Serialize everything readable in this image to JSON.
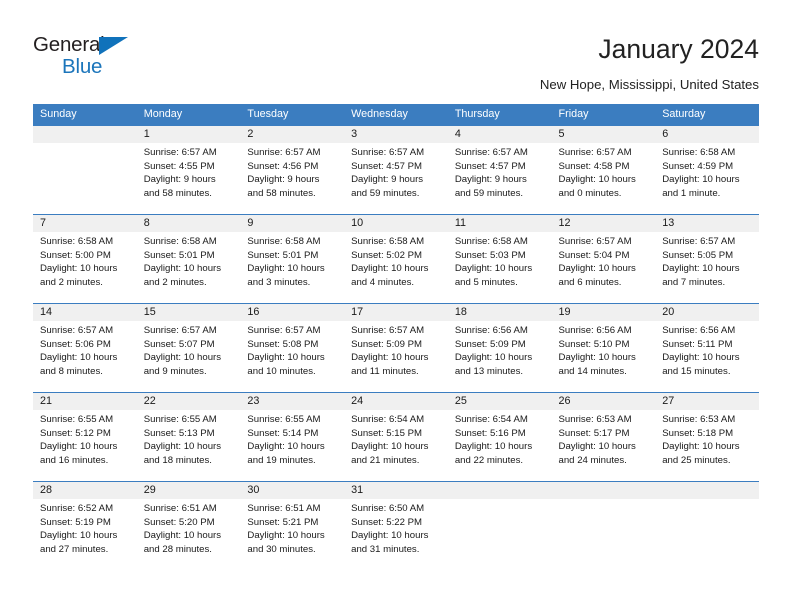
{
  "brand": {
    "name_top": "General",
    "name_bottom": "Blue",
    "triangle_icon": "brand-triangle-icon",
    "color_dark": "#231f20",
    "color_blue": "#1b75bb"
  },
  "header": {
    "title": "January 2024",
    "subtitle": "New Hope, Mississippi, United States"
  },
  "theme": {
    "header_bg": "#3b7dc0",
    "header_text": "#ffffff",
    "daynum_bg": "#f0f0f0",
    "rule_color": "#3b7dc0",
    "body_text": "#1a1a1a"
  },
  "calendar": {
    "weekday_headers": [
      "Sunday",
      "Monday",
      "Tuesday",
      "Wednesday",
      "Thursday",
      "Friday",
      "Saturday"
    ],
    "weeks": [
      [
        {
          "day": "",
          "sunrise": "",
          "sunset": "",
          "daylight_1": "",
          "daylight_2": ""
        },
        {
          "day": "1",
          "sunrise": "Sunrise: 6:57 AM",
          "sunset": "Sunset: 4:55 PM",
          "daylight_1": "Daylight: 9 hours",
          "daylight_2": "and 58 minutes."
        },
        {
          "day": "2",
          "sunrise": "Sunrise: 6:57 AM",
          "sunset": "Sunset: 4:56 PM",
          "daylight_1": "Daylight: 9 hours",
          "daylight_2": "and 58 minutes."
        },
        {
          "day": "3",
          "sunrise": "Sunrise: 6:57 AM",
          "sunset": "Sunset: 4:57 PM",
          "daylight_1": "Daylight: 9 hours",
          "daylight_2": "and 59 minutes."
        },
        {
          "day": "4",
          "sunrise": "Sunrise: 6:57 AM",
          "sunset": "Sunset: 4:57 PM",
          "daylight_1": "Daylight: 9 hours",
          "daylight_2": "and 59 minutes."
        },
        {
          "day": "5",
          "sunrise": "Sunrise: 6:57 AM",
          "sunset": "Sunset: 4:58 PM",
          "daylight_1": "Daylight: 10 hours",
          "daylight_2": "and 0 minutes."
        },
        {
          "day": "6",
          "sunrise": "Sunrise: 6:58 AM",
          "sunset": "Sunset: 4:59 PM",
          "daylight_1": "Daylight: 10 hours",
          "daylight_2": "and 1 minute."
        }
      ],
      [
        {
          "day": "7",
          "sunrise": "Sunrise: 6:58 AM",
          "sunset": "Sunset: 5:00 PM",
          "daylight_1": "Daylight: 10 hours",
          "daylight_2": "and 2 minutes."
        },
        {
          "day": "8",
          "sunrise": "Sunrise: 6:58 AM",
          "sunset": "Sunset: 5:01 PM",
          "daylight_1": "Daylight: 10 hours",
          "daylight_2": "and 2 minutes."
        },
        {
          "day": "9",
          "sunrise": "Sunrise: 6:58 AM",
          "sunset": "Sunset: 5:01 PM",
          "daylight_1": "Daylight: 10 hours",
          "daylight_2": "and 3 minutes."
        },
        {
          "day": "10",
          "sunrise": "Sunrise: 6:58 AM",
          "sunset": "Sunset: 5:02 PM",
          "daylight_1": "Daylight: 10 hours",
          "daylight_2": "and 4 minutes."
        },
        {
          "day": "11",
          "sunrise": "Sunrise: 6:58 AM",
          "sunset": "Sunset: 5:03 PM",
          "daylight_1": "Daylight: 10 hours",
          "daylight_2": "and 5 minutes."
        },
        {
          "day": "12",
          "sunrise": "Sunrise: 6:57 AM",
          "sunset": "Sunset: 5:04 PM",
          "daylight_1": "Daylight: 10 hours",
          "daylight_2": "and 6 minutes."
        },
        {
          "day": "13",
          "sunrise": "Sunrise: 6:57 AM",
          "sunset": "Sunset: 5:05 PM",
          "daylight_1": "Daylight: 10 hours",
          "daylight_2": "and 7 minutes."
        }
      ],
      [
        {
          "day": "14",
          "sunrise": "Sunrise: 6:57 AM",
          "sunset": "Sunset: 5:06 PM",
          "daylight_1": "Daylight: 10 hours",
          "daylight_2": "and 8 minutes."
        },
        {
          "day": "15",
          "sunrise": "Sunrise: 6:57 AM",
          "sunset": "Sunset: 5:07 PM",
          "daylight_1": "Daylight: 10 hours",
          "daylight_2": "and 9 minutes."
        },
        {
          "day": "16",
          "sunrise": "Sunrise: 6:57 AM",
          "sunset": "Sunset: 5:08 PM",
          "daylight_1": "Daylight: 10 hours",
          "daylight_2": "and 10 minutes."
        },
        {
          "day": "17",
          "sunrise": "Sunrise: 6:57 AM",
          "sunset": "Sunset: 5:09 PM",
          "daylight_1": "Daylight: 10 hours",
          "daylight_2": "and 11 minutes."
        },
        {
          "day": "18",
          "sunrise": "Sunrise: 6:56 AM",
          "sunset": "Sunset: 5:09 PM",
          "daylight_1": "Daylight: 10 hours",
          "daylight_2": "and 13 minutes."
        },
        {
          "day": "19",
          "sunrise": "Sunrise: 6:56 AM",
          "sunset": "Sunset: 5:10 PM",
          "daylight_1": "Daylight: 10 hours",
          "daylight_2": "and 14 minutes."
        },
        {
          "day": "20",
          "sunrise": "Sunrise: 6:56 AM",
          "sunset": "Sunset: 5:11 PM",
          "daylight_1": "Daylight: 10 hours",
          "daylight_2": "and 15 minutes."
        }
      ],
      [
        {
          "day": "21",
          "sunrise": "Sunrise: 6:55 AM",
          "sunset": "Sunset: 5:12 PM",
          "daylight_1": "Daylight: 10 hours",
          "daylight_2": "and 16 minutes."
        },
        {
          "day": "22",
          "sunrise": "Sunrise: 6:55 AM",
          "sunset": "Sunset: 5:13 PM",
          "daylight_1": "Daylight: 10 hours",
          "daylight_2": "and 18 minutes."
        },
        {
          "day": "23",
          "sunrise": "Sunrise: 6:55 AM",
          "sunset": "Sunset: 5:14 PM",
          "daylight_1": "Daylight: 10 hours",
          "daylight_2": "and 19 minutes."
        },
        {
          "day": "24",
          "sunrise": "Sunrise: 6:54 AM",
          "sunset": "Sunset: 5:15 PM",
          "daylight_1": "Daylight: 10 hours",
          "daylight_2": "and 21 minutes."
        },
        {
          "day": "25",
          "sunrise": "Sunrise: 6:54 AM",
          "sunset": "Sunset: 5:16 PM",
          "daylight_1": "Daylight: 10 hours",
          "daylight_2": "and 22 minutes."
        },
        {
          "day": "26",
          "sunrise": "Sunrise: 6:53 AM",
          "sunset": "Sunset: 5:17 PM",
          "daylight_1": "Daylight: 10 hours",
          "daylight_2": "and 24 minutes."
        },
        {
          "day": "27",
          "sunrise": "Sunrise: 6:53 AM",
          "sunset": "Sunset: 5:18 PM",
          "daylight_1": "Daylight: 10 hours",
          "daylight_2": "and 25 minutes."
        }
      ],
      [
        {
          "day": "28",
          "sunrise": "Sunrise: 6:52 AM",
          "sunset": "Sunset: 5:19 PM",
          "daylight_1": "Daylight: 10 hours",
          "daylight_2": "and 27 minutes."
        },
        {
          "day": "29",
          "sunrise": "Sunrise: 6:51 AM",
          "sunset": "Sunset: 5:20 PM",
          "daylight_1": "Daylight: 10 hours",
          "daylight_2": "and 28 minutes."
        },
        {
          "day": "30",
          "sunrise": "Sunrise: 6:51 AM",
          "sunset": "Sunset: 5:21 PM",
          "daylight_1": "Daylight: 10 hours",
          "daylight_2": "and 30 minutes."
        },
        {
          "day": "31",
          "sunrise": "Sunrise: 6:50 AM",
          "sunset": "Sunset: 5:22 PM",
          "daylight_1": "Daylight: 10 hours",
          "daylight_2": "and 31 minutes."
        },
        {
          "day": "",
          "sunrise": "",
          "sunset": "",
          "daylight_1": "",
          "daylight_2": ""
        },
        {
          "day": "",
          "sunrise": "",
          "sunset": "",
          "daylight_1": "",
          "daylight_2": ""
        },
        {
          "day": "",
          "sunrise": "",
          "sunset": "",
          "daylight_1": "",
          "daylight_2": ""
        }
      ]
    ]
  }
}
